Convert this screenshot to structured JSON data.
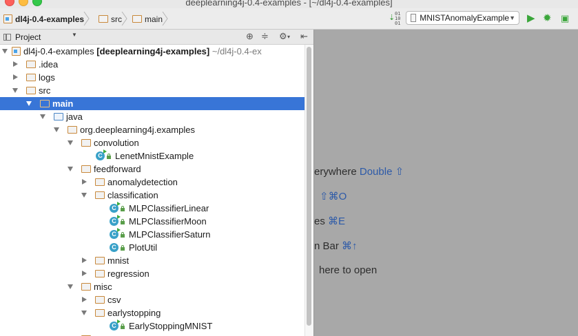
{
  "window": {
    "title": "deeplearning4j-0.4-examples - [~/dl4j-0.4-examples]"
  },
  "breadcrumbs": [
    "dl4j-0.4-examples",
    "src",
    "main"
  ],
  "toolbar": {
    "run_config": "MNISTAnomalyExample"
  },
  "project_panel": {
    "title": "Project"
  },
  "tree": [
    {
      "label": "dl4j-0.4-examples",
      "label_bold": "[deeplearning4j-examples]",
      "label_path": "~/dl4j-0.4-ex"
    },
    {
      "label": ".idea"
    },
    {
      "label": "logs"
    },
    {
      "label": "src"
    },
    {
      "label": "main"
    },
    {
      "label": "java"
    },
    {
      "label": "org.deeplearning4j.examples"
    },
    {
      "label": "convolution"
    },
    {
      "label": "LenetMnistExample"
    },
    {
      "label": "feedforward"
    },
    {
      "label": "anomalydetection"
    },
    {
      "label": "classification"
    },
    {
      "label": "MLPClassifierLinear"
    },
    {
      "label": "MLPClassifierMoon"
    },
    {
      "label": "MLPClassifierSaturn"
    },
    {
      "label": "PlotUtil"
    },
    {
      "label": "mnist"
    },
    {
      "label": "regression"
    },
    {
      "label": "misc"
    },
    {
      "label": "csv"
    },
    {
      "label": "earlystopping"
    },
    {
      "label": "EarlyStoppingMNIST"
    }
  ],
  "editor_hints": [
    {
      "text": "erywhere",
      "key": "Double ⇧"
    },
    {
      "text": "",
      "key": "⇧⌘O"
    },
    {
      "text": "es",
      "key": "⌘E"
    },
    {
      "text": "n Bar",
      "key": "⌘↑"
    },
    {
      "text": "here to open",
      "key": ""
    }
  ],
  "colors": {
    "selection": "#3875d7",
    "editor_bg": "#a8a8a8",
    "shortcut": "#2d5aa8"
  }
}
